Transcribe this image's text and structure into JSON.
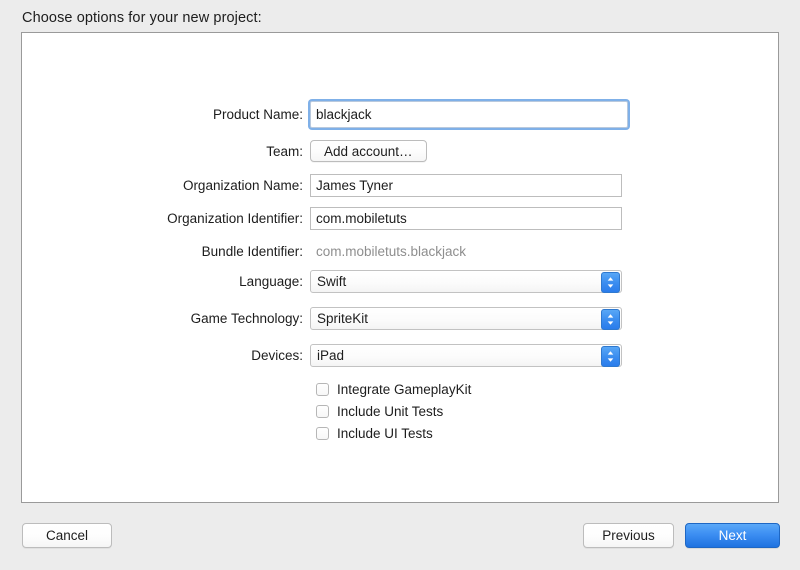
{
  "header": {
    "title": "Choose options for your new project:"
  },
  "form": {
    "fields": [
      {
        "label": "Product Name:",
        "type": "textfield",
        "value": "blackjack",
        "placeholder": "",
        "focused": true,
        "name": "product-name"
      },
      {
        "label": "Team:",
        "type": "button",
        "value": "Add account…",
        "name": "team"
      },
      {
        "label": "Organization Name:",
        "type": "textfield",
        "value": "James Tyner",
        "placeholder": "",
        "focused": false,
        "name": "organization-name"
      },
      {
        "label": "Organization Identifier:",
        "type": "textfield",
        "value": "com.mobiletuts",
        "placeholder": "",
        "focused": false,
        "name": "organization-identifier"
      },
      {
        "label": "Bundle Identifier:",
        "type": "static",
        "value": "com.mobiletuts.blackjack",
        "name": "bundle-identifier"
      },
      {
        "label": "Language:",
        "type": "popup",
        "value": "Swift",
        "name": "language"
      },
      {
        "label": "Game Technology:",
        "type": "popup",
        "value": "SpriteKit",
        "name": "game-technology"
      },
      {
        "label": "Devices:",
        "type": "popup",
        "value": "iPad",
        "name": "devices"
      }
    ],
    "checkboxes": [
      {
        "label": "Integrate GameplayKit",
        "checked": false,
        "name": "integrate-gameplaykit"
      },
      {
        "label": "Include Unit Tests",
        "checked": false,
        "name": "include-unit-tests"
      },
      {
        "label": "Include UI Tests",
        "checked": false,
        "name": "include-ui-tests"
      }
    ]
  },
  "footer": {
    "cancel_label": "Cancel",
    "previous_label": "Previous",
    "next_label": "Next"
  },
  "icons": {
    "stepper": "chevron-up-down-icon"
  },
  "colors": {
    "window_background": "#ececec",
    "panel_background": "#ffffff",
    "panel_border": "#9a9a9a",
    "accent_blue": "#3c8ef2",
    "focus_ring": "#7fb0e8",
    "disabled_text": "#8e8e8e",
    "text": "#1d1d1d"
  }
}
